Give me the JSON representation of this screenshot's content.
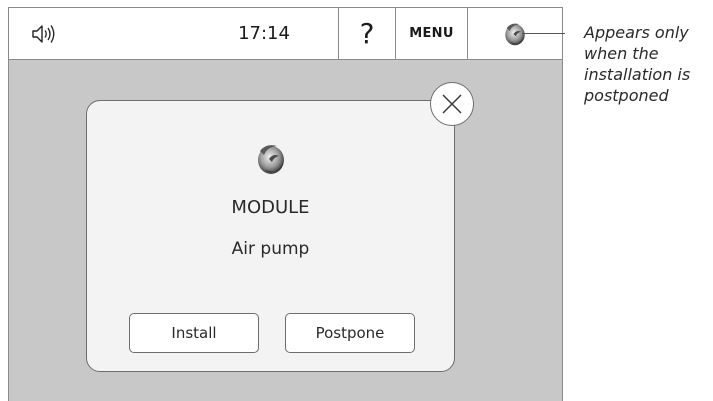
{
  "statusbar": {
    "speaker_icon": "speaker-volume-icon",
    "time": "17:14",
    "help_label": "?",
    "menu_label": "MENU",
    "module_icon": "module-swirl-icon"
  },
  "dialog": {
    "icon": "module-swirl-icon",
    "close_icon": "close-x-icon",
    "title": "MODULE",
    "subtitle": "Air pump",
    "buttons": {
      "install": "Install",
      "postpone": "Postpone"
    }
  },
  "annotation": {
    "text": "Appears only when the installation is postponed"
  },
  "colors": {
    "screen_background": "#c8c8c8",
    "dialog_background": "#f3f3f3",
    "border": "#6e6e6e"
  }
}
